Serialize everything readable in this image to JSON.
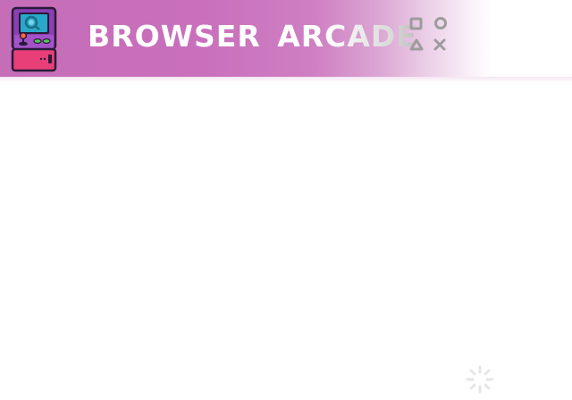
{
  "header": {
    "title": "BROWSER ARCADE",
    "logo_icon": "arcade-cabinet-icon",
    "controls_icon": "playstation-buttons-icon"
  },
  "footer": {
    "icon": "spinner-icon"
  },
  "colors": {
    "header_pink": "#c66db8",
    "title_text": "#ffffff",
    "cabinet_purple": "#8a3fb2",
    "cabinet_base": "#e83f79",
    "screen_teal": "#29a9c9",
    "button_green": "#55c85a",
    "joystick_orange": "#ff6a3c",
    "controls_gray": "#9c9c9c"
  }
}
